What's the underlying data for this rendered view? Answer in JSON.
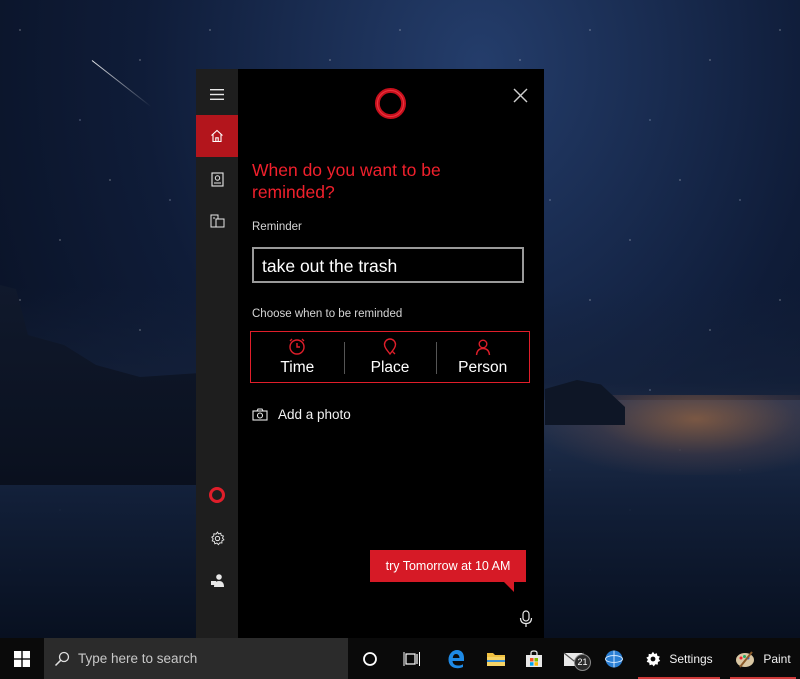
{
  "cortana": {
    "question": "When do you want to be reminded?",
    "reminder_label": "Reminder",
    "reminder_value": "take out the trash",
    "choose_label": "Choose when to be reminded",
    "choices": [
      {
        "label": "Time",
        "icon": "clock-icon"
      },
      {
        "label": "Place",
        "icon": "location-pin-icon"
      },
      {
        "label": "Person",
        "icon": "person-icon"
      }
    ],
    "add_photo_label": "Add a photo",
    "suggestion": "try Tomorrow at 10 AM",
    "accent_color": "#e01e2a"
  },
  "sidebar": {
    "items": [
      {
        "name": "menu",
        "icon": "hamburger-icon"
      },
      {
        "name": "home",
        "icon": "home-icon",
        "active": true
      },
      {
        "name": "notebook",
        "icon": "notebook-icon"
      },
      {
        "name": "devices",
        "icon": "devices-icon"
      },
      {
        "name": "cortana",
        "icon": "cortana-icon"
      },
      {
        "name": "settings",
        "icon": "gear-icon"
      },
      {
        "name": "feedback",
        "icon": "feedback-icon"
      }
    ]
  },
  "taskbar": {
    "search_placeholder": "Type here to search",
    "mail_badge": "21",
    "settings_label": "Settings",
    "paint_label": "Paint"
  }
}
